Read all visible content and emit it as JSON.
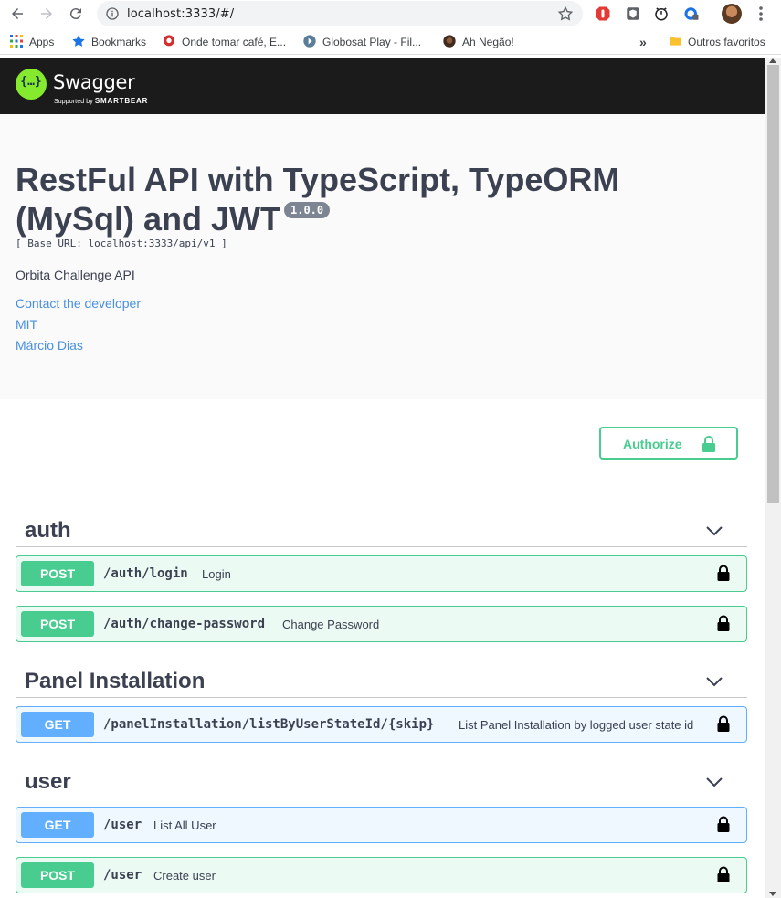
{
  "browser": {
    "url": "localhost:3333/#/",
    "bookmarks": [
      {
        "label": "Apps",
        "icon": "apps-grid-icon"
      },
      {
        "label": "Bookmarks",
        "icon": "star-icon"
      },
      {
        "label": "Onde tomar café, E...",
        "icon": "location-pin-icon"
      },
      {
        "label": "Globosat Play - Fil...",
        "icon": "play-icon"
      },
      {
        "label": "Ah Negão!",
        "icon": "avatar-icon"
      }
    ],
    "overflow_label": "»",
    "other_favorites": "Outros favoritos"
  },
  "topbar": {
    "logo_mark": "{…}",
    "logo_text": "Swagger",
    "logo_sub_prefix": "Supported by",
    "logo_sub_brand": "SMARTBEAR",
    "brand_color": "#85ea2d"
  },
  "info": {
    "title": "RestFul API with TypeScript, TypeORM (MySql) and JWT",
    "version": "1.0.0",
    "base_url": "[ Base URL: localhost:3333/api/v1 ]",
    "description": "Orbita Challenge API",
    "links": [
      "Contact the developer",
      "MIT",
      "Márcio Dias"
    ]
  },
  "scheme": {
    "authorize_label": "Authorize"
  },
  "tags": [
    {
      "name": "auth",
      "operations": [
        {
          "method": "POST",
          "path": "/auth/login",
          "summary": "Login"
        },
        {
          "method": "POST",
          "path": "/auth/change-password",
          "summary": "Change Password"
        }
      ]
    },
    {
      "name": "Panel Installation",
      "operations": [
        {
          "method": "GET",
          "path": "/panelInstallation/listByUserStateId/{skip}",
          "summary": "List Panel Installation by logged user state id"
        }
      ]
    },
    {
      "name": "user",
      "operations": [
        {
          "method": "GET",
          "path": "/user",
          "summary": "List All User"
        },
        {
          "method": "POST",
          "path": "/user",
          "summary": "Create user"
        }
      ]
    }
  ],
  "colors": {
    "post": "#49cc90",
    "get": "#61afe",
    "text": "#3b4151",
    "link": "#4990e2"
  }
}
